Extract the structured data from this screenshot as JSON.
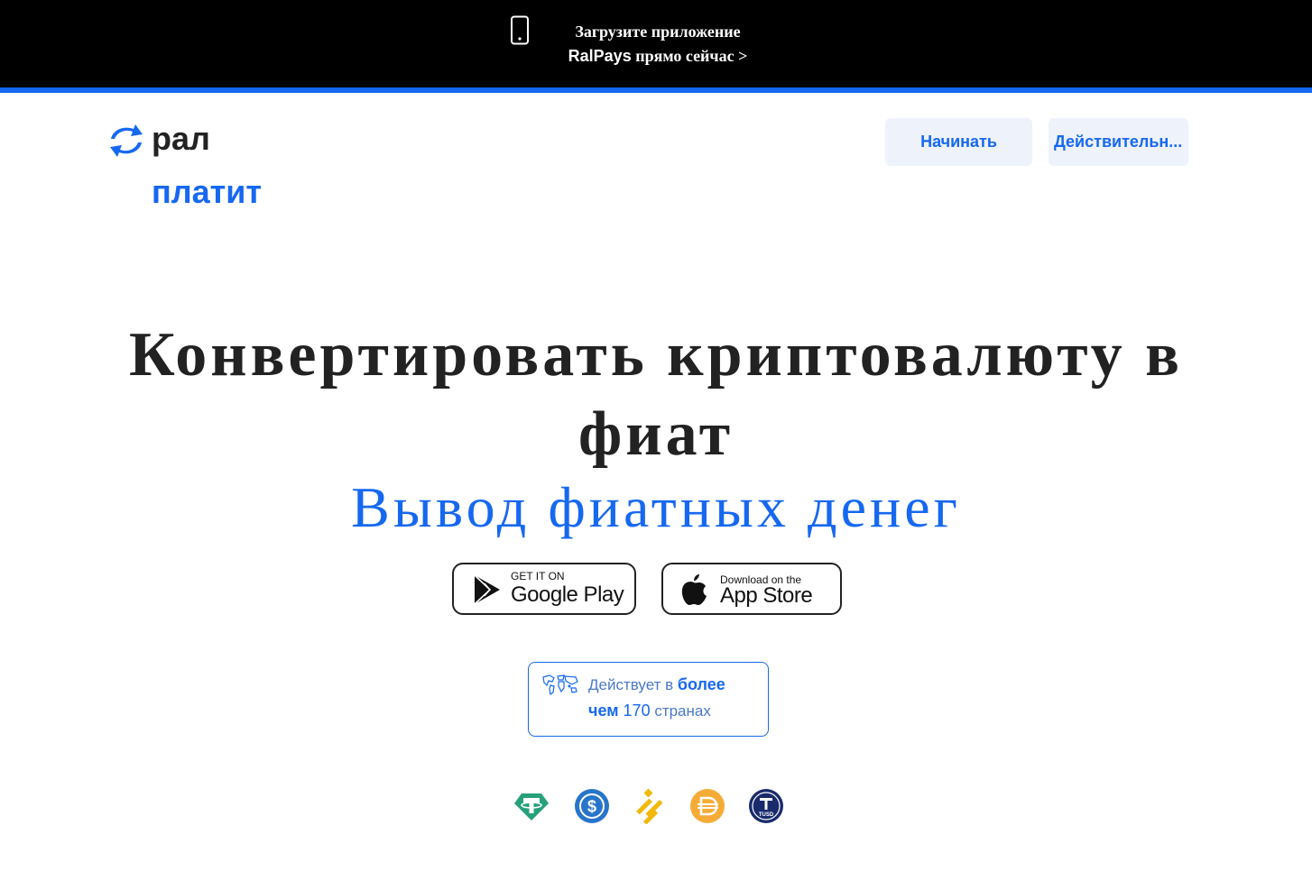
{
  "banner": {
    "line1": "Загрузите приложение",
    "brand": "RalPays",
    "line2_rest": " прямо сейчас >",
    "bg_color": "#000000",
    "accent_line_color": "#1668f0"
  },
  "header": {
    "logo_word1": "рал",
    "logo_word2": "платит",
    "start_button": "Начинать",
    "verify_button": "Действительн..."
  },
  "hero": {
    "title": "Конвертировать криптовалюту в фиат",
    "subtitle": "Вывод фиатных денег"
  },
  "stores": {
    "google_small": "GET IT ON",
    "google_big": "Google Play",
    "apple_small": "Download on the",
    "apple_big": "App Store"
  },
  "countries": {
    "prefix": "Действует в ",
    "bold1": "более",
    "bold2": "чем",
    "number": " 170",
    "suffix": " странах"
  },
  "coins": {
    "tusd_label": "TUSD",
    "icons": [
      "tether-icon",
      "usdc-icon",
      "binance-icon",
      "dai-icon",
      "tusd-icon"
    ]
  },
  "colors": {
    "brand_blue": "#1668f0",
    "button_bg": "#eef2fb"
  }
}
